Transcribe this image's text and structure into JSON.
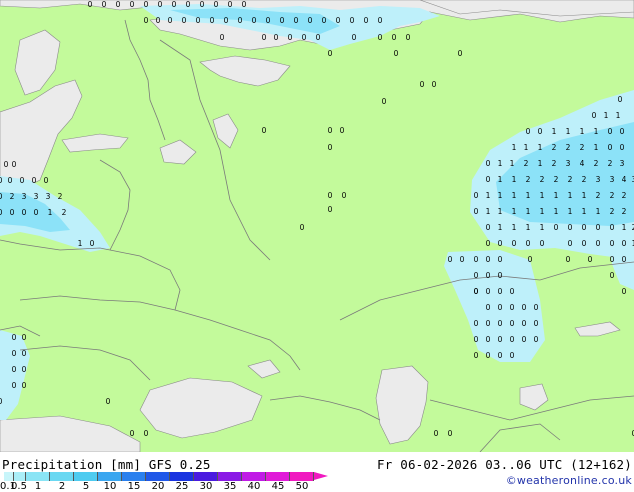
{
  "title": "Precipitation [mm]  GFS 0.25",
  "timestamp": "Fr 06-02-2026 03..06 UTC (12+162)",
  "credit": "©weatheronline.co.uk",
  "legend": {
    "ticks": [
      "0.1",
      "0.5",
      "1",
      "2",
      "5",
      "10",
      "15",
      "20",
      "25",
      "30",
      "35",
      "40",
      "45",
      "50"
    ],
    "colors": [
      "#c8f5fa",
      "#aaeef8",
      "#8ae4f5",
      "#6ad8f2",
      "#4ecbf0",
      "#3aa6f0",
      "#2a80ee",
      "#2058e8",
      "#1a34e0",
      "#4a1ae0",
      "#8a1ae6",
      "#c01ae6",
      "#e01ad8",
      "#f01ac0"
    ]
  },
  "colors": {
    "land": "#c3fa9b",
    "sea": "#ebebeb",
    "precip_light": "#bef0fa",
    "precip_mid": "#8ce2f8",
    "border": "#7a7a7a"
  },
  "grid_labels": {
    "arctic_row1": [
      "0",
      "0",
      "0",
      "0",
      "0",
      "0",
      "0",
      "0",
      "0",
      "0",
      "0",
      "0"
    ],
    "arctic_row2": [
      "0",
      "0",
      "0",
      "0",
      "0",
      "0",
      "0",
      "0",
      "0",
      "0",
      "0",
      "0",
      "0",
      "0",
      "0",
      "0",
      "0",
      "0"
    ],
    "arctic_row3": [
      "0",
      "0",
      "0",
      "0",
      "0",
      "0",
      "0",
      "0",
      "0",
      "0"
    ],
    "arctic_row4": [
      "0",
      "0",
      "0"
    ],
    "north_scattered": [
      "0",
      "0",
      "0",
      "0",
      "0",
      "0",
      "0",
      "0",
      "0",
      "0",
      "0",
      "0"
    ],
    "baltic_rows": [
      [
        "0",
        "0"
      ],
      [
        "0",
        "0",
        "0",
        "0",
        "0"
      ],
      [
        "0",
        "2",
        "3",
        "3",
        "3",
        "2"
      ],
      [
        "0",
        "0",
        "0",
        "0",
        "1",
        "2"
      ],
      [
        "1",
        "0"
      ]
    ],
    "siberia_rows": [
      [
        "0",
        "1",
        "1"
      ],
      [
        "0",
        "0",
        "1",
        "1",
        "1",
        "1",
        "0",
        "0"
      ],
      [
        "1",
        "1",
        "1",
        "2",
        "2",
        "2",
        "1",
        "0",
        "0"
      ],
      [
        "0",
        "1",
        "1",
        "2",
        "1",
        "2",
        "3",
        "4",
        "2",
        "2",
        "3"
      ],
      [
        "0",
        "1",
        "1",
        "2",
        "2",
        "2",
        "2",
        "2",
        "3",
        "3",
        "4",
        "3"
      ],
      [
        "0",
        "1",
        "1",
        "1",
        "1",
        "1",
        "1",
        "1",
        "1",
        "2",
        "2",
        "2"
      ],
      [
        "0",
        "1",
        "1",
        "1",
        "1",
        "1",
        "1",
        "1",
        "1",
        "1",
        "2",
        "2"
      ],
      [
        "0",
        "1",
        "1",
        "1",
        "1",
        "0",
        "0",
        "0",
        "0",
        "0",
        "1",
        "2"
      ],
      [
        "0",
        "0",
        "0",
        "0",
        "0",
        "0",
        "0",
        "0",
        "0",
        "0",
        "1"
      ]
    ],
    "central_asia_rows": [
      [
        "0",
        "0",
        "0",
        "0",
        "0",
        "0",
        "0",
        "0",
        "0",
        "0"
      ],
      [
        "0",
        "0",
        "0",
        "0"
      ],
      [
        "0",
        "0",
        "0",
        "0",
        "0",
        "0"
      ],
      [
        "0",
        "0",
        "0",
        "0",
        "0"
      ],
      [
        "0",
        "0",
        "0",
        "0",
        "0",
        "0"
      ],
      [
        "0",
        "0",
        "0",
        "0",
        "0",
        "0"
      ]
    ],
    "south_scattered": [
      "0",
      "0",
      "0",
      "0",
      "0",
      "0",
      "0",
      "0",
      "0",
      "0",
      "0",
      "0",
      "0",
      "0",
      "0",
      "0",
      "0",
      "0",
      "0"
    ]
  }
}
